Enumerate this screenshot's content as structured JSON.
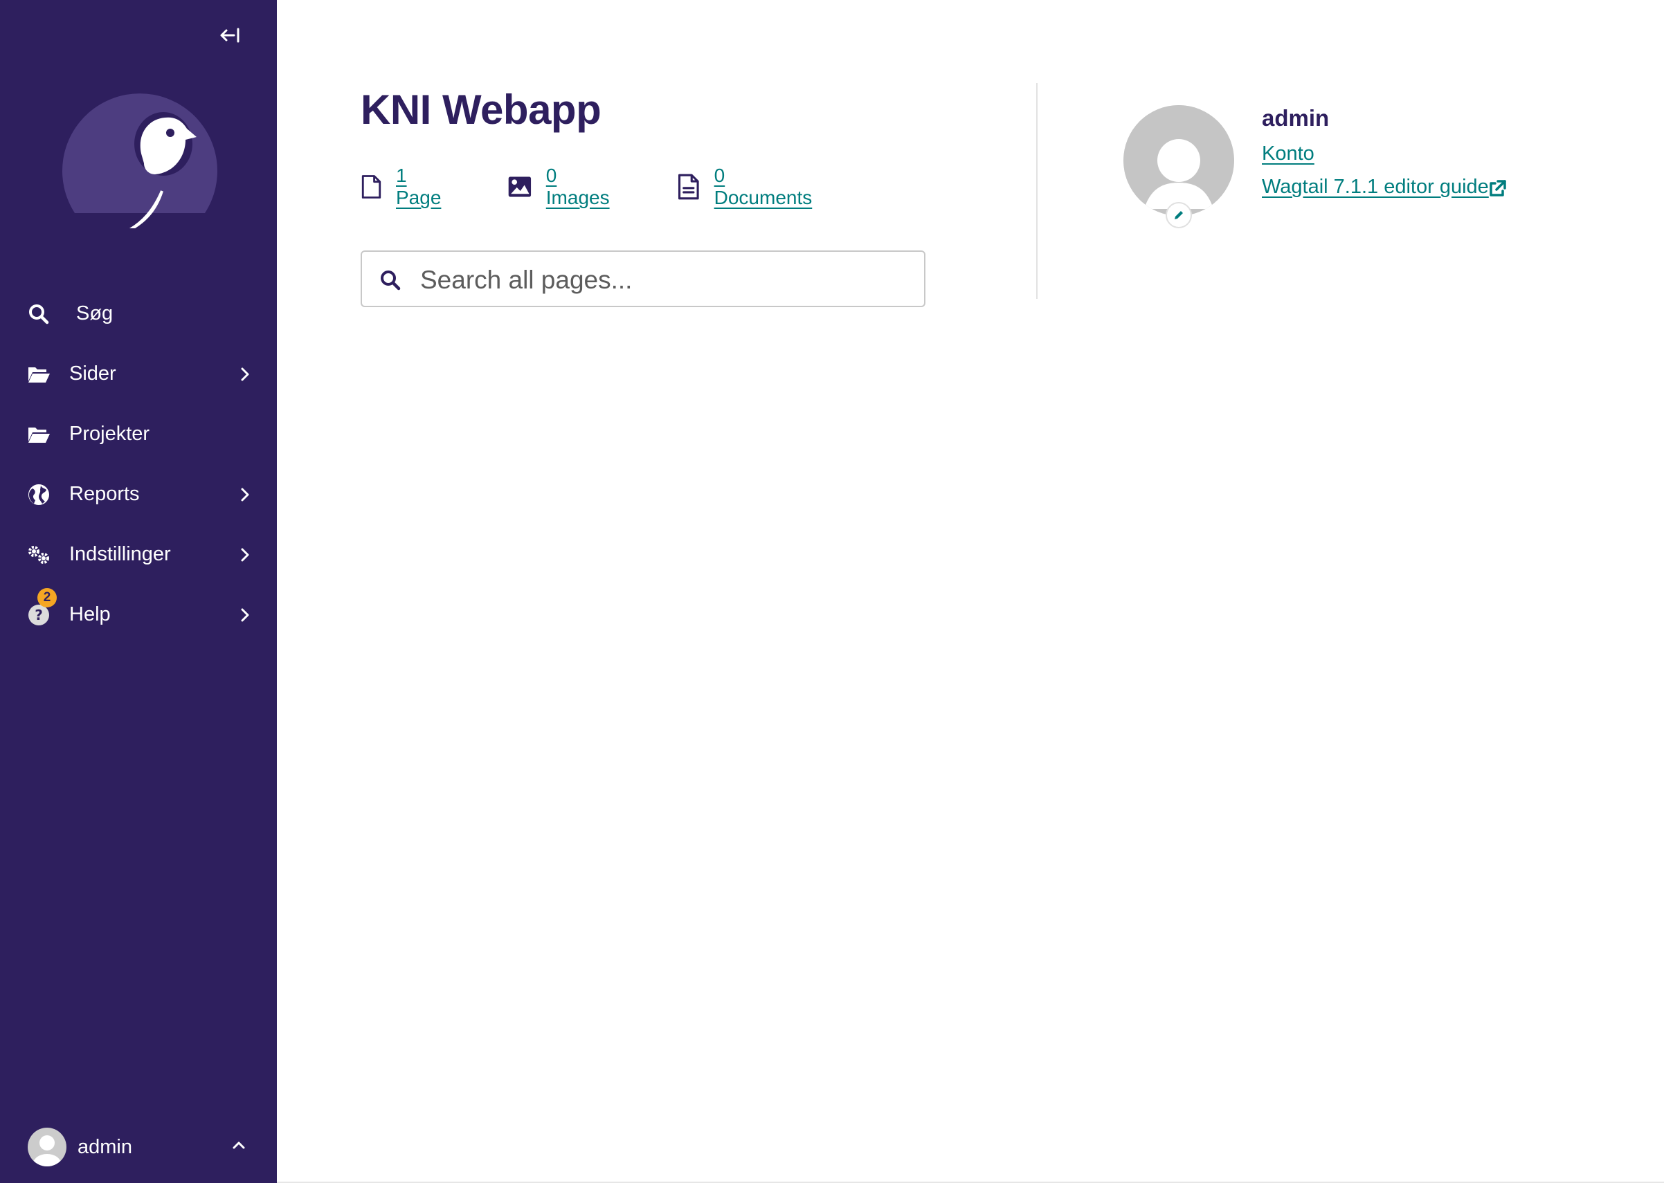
{
  "sidebar": {
    "collapse_icon": "collapse-left-icon",
    "logo": "wagtail-logo",
    "items": [
      {
        "label": "Søg",
        "icon": "search-icon",
        "has_submenu": false
      },
      {
        "label": "Sider",
        "icon": "folder-open-icon",
        "has_submenu": true
      },
      {
        "label": "Projekter",
        "icon": "folder-open-icon",
        "has_submenu": false
      },
      {
        "label": "Reports",
        "icon": "globe-icon",
        "has_submenu": true
      },
      {
        "label": "Indstillinger",
        "icon": "cogs-icon",
        "has_submenu": true
      },
      {
        "label": "Help",
        "icon": "help-icon",
        "has_submenu": true,
        "badge": "2"
      }
    ],
    "user": {
      "name": "admin"
    }
  },
  "main": {
    "title": "KNI Webapp",
    "stats": [
      {
        "label": "1 Page",
        "icon": "doc-empty-icon"
      },
      {
        "label": "0 Images",
        "icon": "image-icon"
      },
      {
        "label": "0 Documents",
        "icon": "doc-full-icon"
      }
    ],
    "search": {
      "placeholder": "Search all pages..."
    }
  },
  "profile": {
    "name": "admin",
    "account_link": "Konto",
    "guide_link": "Wagtail 7.1.1 editor guide"
  },
  "colors": {
    "sidebar_bg": "#2e1f5e",
    "title": "#2e1f5e",
    "link": "#007d7e",
    "badge": "#f5a623"
  }
}
